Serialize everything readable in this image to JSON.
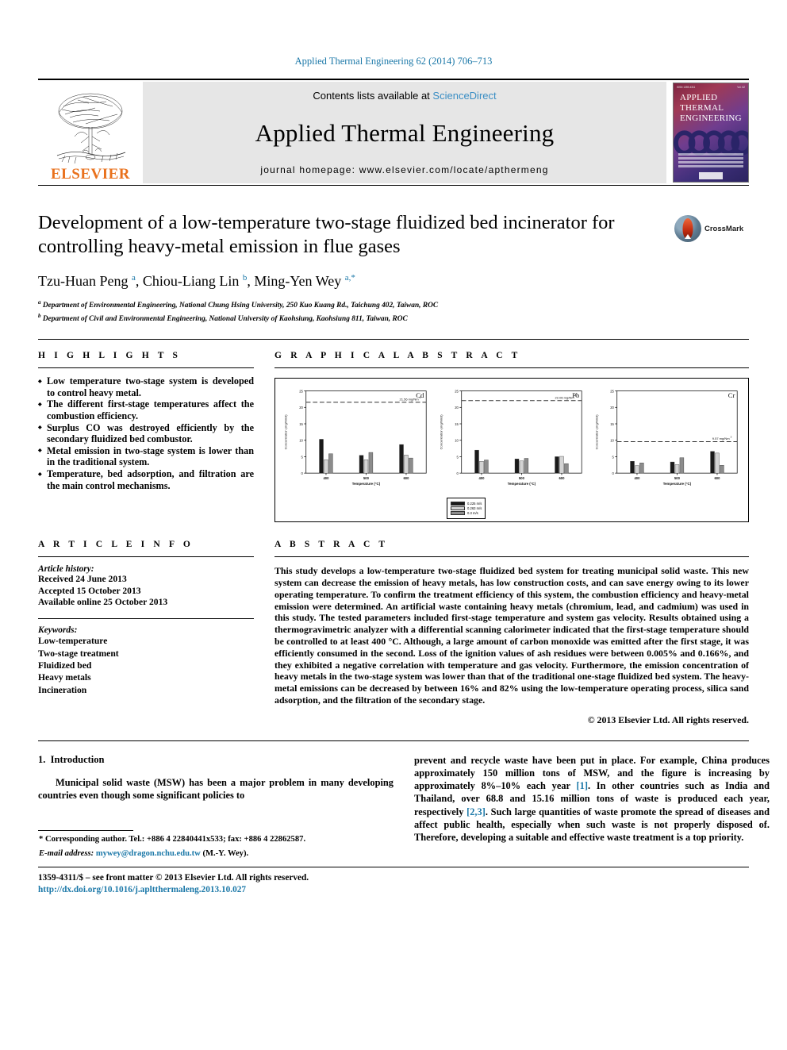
{
  "running_head": "Applied Thermal Engineering 62 (2014) 706–713",
  "masthead": {
    "contents_prefix": "Contents lists available at",
    "sciencedirect": "ScienceDirect",
    "journal_name": "Applied Thermal Engineering",
    "homepage": "journal homepage: www.elsevier.com/locate/apthermeng",
    "publisher": "ELSEVIER",
    "cover": {
      "line1": "APPLIED",
      "line2": "THERMAL",
      "line3": "ENGINEERING",
      "top_left": "ISSN 1359-4311",
      "top_right": "Vol. 62"
    }
  },
  "article": {
    "title": "Development of a low-temperature two-stage fluidized bed incinerator for controlling heavy-metal emission in flue gases",
    "authors_html": "Tzu-Huan Peng <sup>a</sup>, Chiou-Liang Lin <sup>b</sup>, Ming-Yen Wey <sup>a,*</sup>",
    "affiliation_a": "Department of Environmental Engineering, National Chung Hsing University, 250 Kuo Kuang Rd., Taichung 402, Taiwan, ROC",
    "affiliation_b": "Department of Civil and Environmental Engineering, National University of Kaohsiung, Kaohsiung 811, Taiwan, ROC",
    "crossmark_label": "CrossMark"
  },
  "highlights": {
    "heading": "H I G H L I G H T S",
    "items": [
      "Low temperature two-stage system is developed to control heavy metal.",
      "The different first-stage temperatures affect the combustion efficiency.",
      "Surplus CO was destroyed efficiently by the secondary fluidized bed combustor.",
      "Metal emission in two-stage system is lower than in the traditional system.",
      "Temperature, bed adsorption, and filtration are the main control mechanisms."
    ]
  },
  "graphical_abstract": {
    "heading": "G R A P H I C A L   A B S T R A C T"
  },
  "article_info": {
    "heading": "A R T I C L E   I N F O",
    "history_label": "Article history:",
    "history": [
      "Received 24 June 2013",
      "Accepted 15 October 2013",
      "Available online 25 October 2013"
    ],
    "keywords_label": "Keywords:",
    "keywords": [
      "Low-temperature",
      "Two-stage treatment",
      "Fluidized bed",
      "Heavy metals",
      "Incineration"
    ]
  },
  "abstract": {
    "heading": "A B S T R A C T",
    "text": "This study develops a low-temperature two-stage fluidized bed system for treating municipal solid waste. This new system can decrease the emission of heavy metals, has low construction costs, and can save energy owing to its lower operating temperature. To confirm the treatment efficiency of this system, the combustion efficiency and heavy-metal emission were determined. An artificial waste containing heavy metals (chromium, lead, and cadmium) was used in this study. The tested parameters included first-stage temperature and system gas velocity. Results obtained using a thermogravimetric analyzer with a differential scanning calorimeter indicated that the first-stage temperature should be controlled to at least 400 °C. Although, a large amount of carbon monoxide was emitted after the first stage, it was efficiently consumed in the second. Loss of the ignition values of ash residues were between 0.005% and 0.166%, and they exhibited a negative correlation with temperature and gas velocity. Furthermore, the emission concentration of heavy metals in the two-stage system was lower than that of the traditional one-stage fluidized bed system. The heavy-metal emissions can be decreased by between 16% and 82% using the low-temperature operating process, silica sand adsorption, and the filtration of the secondary stage.",
    "copyright": "© 2013 Elsevier Ltd. All rights reserved."
  },
  "body": {
    "section_number": "1.",
    "section_title": "Introduction",
    "col1_p1": "Municipal solid waste (MSW) has been a major problem in many developing countries even though some significant policies to",
    "col2_p1a": "prevent and recycle waste have been put in place. For example, China produces approximately 150 million tons of MSW, and the figure is increasing by approximately 8%–10% each year ",
    "col2_ref1": "[1]",
    "col2_p1b": ". In other countries such as India and Thailand, over 68.8 and 15.16 million tons of waste is produced each year, respectively ",
    "col2_ref2": "[2,3]",
    "col2_p1c": ". Such large quantities of waste promote the spread of diseases and affect public health, especially when such waste is not properly disposed of. Therefore, developing a suitable and effective waste treatment is a top priority."
  },
  "footnotes": {
    "corresponding": "* Corresponding author. Tel.: +886 4 22840441x533; fax: +886 4 22862587.",
    "email_label": "E-mail address:",
    "email": "mywey@dragon.nchu.edu.tw",
    "email_suffix": "(M.-Y. Wey).",
    "frontmatter": "1359-4311/$ – see front matter © 2013 Elsevier Ltd. All rights reserved.",
    "doi": "http://dx.doi.org/10.1016/j.apltthermaleng.2013.10.027"
  },
  "chart_data": [
    {
      "type": "bar",
      "title": "Cd",
      "xlabel": "Temperature (°C)",
      "ylabel": "Concentration (mg/Nm3)",
      "categories": [
        "400",
        "500",
        "600"
      ],
      "ylim": [
        0,
        25
      ],
      "yticks": [
        0,
        5,
        10,
        15,
        20,
        25
      ],
      "series": [
        {
          "name": "0.225 m/s",
          "values": [
            10.3,
            5.4,
            8.7
          ]
        },
        {
          "name": "0.263 m/s",
          "values": [
            4.1,
            4.1,
            5.5
          ]
        },
        {
          "name": "0.3 m/s",
          "values": [
            5.9,
            6.3,
            4.6
          ]
        }
      ],
      "reference_line": {
        "value": 21.56,
        "label": "21.56 mg/Nm",
        "sup": "3"
      }
    },
    {
      "type": "bar",
      "title": "Pb",
      "xlabel": "Temperature (°C)",
      "ylabel": "Concentration (mg/Nm3)",
      "categories": [
        "400",
        "500",
        "600"
      ],
      "ylim": [
        0,
        25
      ],
      "yticks": [
        0,
        5,
        10,
        15,
        20,
        25
      ],
      "series": [
        {
          "name": "0.225 m/s",
          "values": [
            7.0,
            4.3,
            5.0
          ]
        },
        {
          "name": "0.263 m/s",
          "values": [
            3.6,
            3.7,
            5.1
          ]
        },
        {
          "name": "0.3 m/s",
          "values": [
            4.0,
            4.5,
            2.9
          ]
        }
      ],
      "reference_line": {
        "value": 22.06,
        "label": "22.06 mg/Nm",
        "sup": "3"
      }
    },
    {
      "type": "bar",
      "title": "Cr",
      "xlabel": "Temperature (°C)",
      "ylabel": "Concentration (mg/Nm3)",
      "categories": [
        "400",
        "500",
        "600"
      ],
      "ylim": [
        0,
        25
      ],
      "yticks": [
        0,
        5,
        10,
        15,
        20,
        25
      ],
      "series": [
        {
          "name": "0.225 m/s",
          "values": [
            3.6,
            3.4,
            6.6
          ]
        },
        {
          "name": "0.263 m/s",
          "values": [
            2.3,
            2.6,
            6.1
          ]
        },
        {
          "name": "0.3 m/s",
          "values": [
            3.1,
            4.7,
            2.4
          ]
        }
      ],
      "reference_line": {
        "value": 9.57,
        "label": "9.57 mg/Nm",
        "sup": "3"
      }
    }
  ],
  "chart_legend": [
    {
      "label": "0.225 m/s",
      "color": "#1a1a1a"
    },
    {
      "label": "0.263 m/s",
      "color": "#d4d4d4"
    },
    {
      "label": "0.3 m/s",
      "color": "#8c8c8c"
    }
  ]
}
